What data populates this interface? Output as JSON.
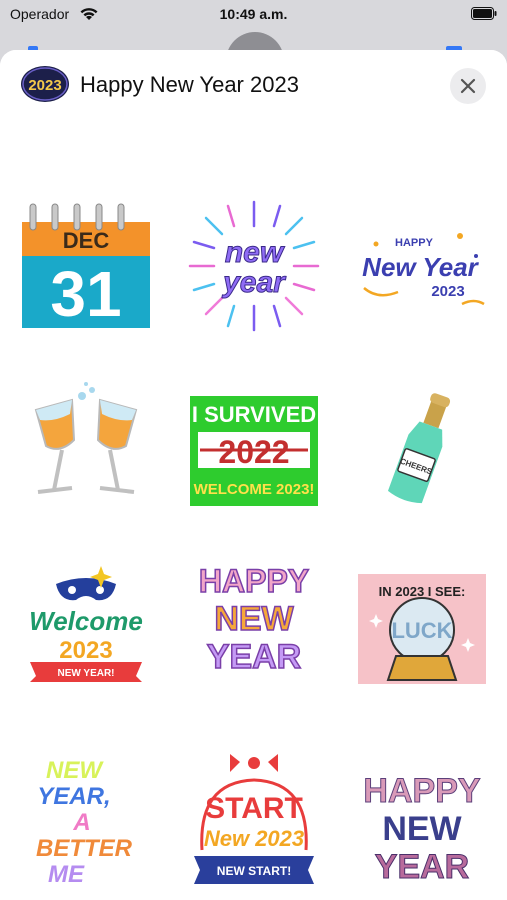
{
  "status_bar": {
    "carrier": "Operador",
    "time": "10:49 a.m.",
    "wifi_icon": "wifi-icon",
    "battery_icon": "battery-icon"
  },
  "header": {
    "title": "Happy New Year 2023",
    "icon_text": "2023",
    "close_icon": "close-icon"
  },
  "stickers": [
    {
      "id": "calendar",
      "lines": [
        "DEC",
        "31"
      ]
    },
    {
      "id": "new-year-burst",
      "lines": [
        "new",
        "year"
      ]
    },
    {
      "id": "happy-new-year-2023",
      "lines": [
        "HAPPY",
        "New Year",
        "2023"
      ]
    },
    {
      "id": "champagne-glasses",
      "lines": []
    },
    {
      "id": "survived-2022",
      "lines": [
        "I SURVIVED",
        "2022",
        "WELCOME 2023!"
      ]
    },
    {
      "id": "champagne-bottle",
      "lines": [
        "CHEERS"
      ]
    },
    {
      "id": "welcome-2023",
      "lines": [
        "Welcome",
        "2023",
        "NEW YEAR!"
      ]
    },
    {
      "id": "happy-new-year-lettering",
      "lines": [
        "HAPPY",
        "NEW",
        "YEAR"
      ]
    },
    {
      "id": "crystal-ball-luck",
      "lines": [
        "IN 2023 I SEE:",
        "LUCK"
      ]
    },
    {
      "id": "new-year-better-me",
      "lines": [
        "NEW",
        "YEAR,",
        "A",
        "BETTER",
        "ME"
      ]
    },
    {
      "id": "start-new-2023",
      "lines": [
        "START",
        "New 2023",
        "NEW START!"
      ]
    },
    {
      "id": "happy-new-year-fireworks",
      "lines": [
        "HAPPY",
        "NEW",
        "YEAR"
      ]
    }
  ],
  "colors": {
    "sheet": "#ffffff",
    "backdrop": "#d8d8dc",
    "close_bg": "#ececee",
    "calendar_orange": "#f3922a",
    "calendar_teal": "#1aa9c9",
    "survived_green": "#2ecc2e"
  }
}
